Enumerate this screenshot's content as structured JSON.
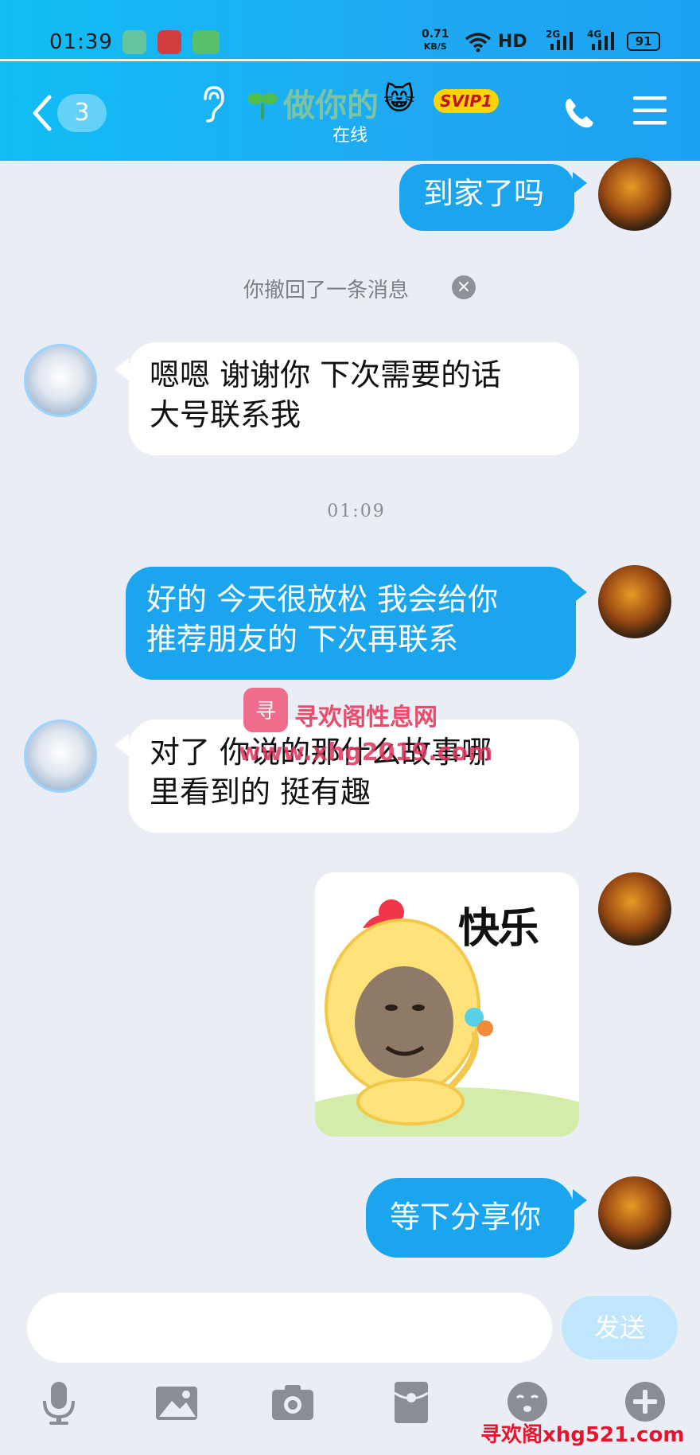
{
  "status_bar": {
    "time": "01:39",
    "net_speed_value": "0.71",
    "net_speed_unit": "KB/S",
    "hd": "HD",
    "sig1": "2G",
    "sig2": "4G",
    "battery": "91"
  },
  "header": {
    "unread_count": "3",
    "contact_name": "做你的",
    "badge": "SVIP1",
    "status": "在线",
    "cat_emoji": "😸"
  },
  "messages": [
    {
      "from": "me",
      "text": "到家了吗"
    },
    {
      "type": "system",
      "text": "你撤回了一条消息"
    },
    {
      "from": "other",
      "text": "嗯嗯 谢谢你 下次需要的话\n大号联系我"
    },
    {
      "type": "timestamp",
      "text": "01:09"
    },
    {
      "from": "me",
      "text": "好的 今天很放松 我会给你\n推荐朋友的 下次再联系"
    },
    {
      "from": "other",
      "text": "对了 你说的那什么故事哪\n里看到的 挺有趣"
    },
    {
      "from": "me",
      "type": "sticker",
      "text": "快乐"
    },
    {
      "from": "me",
      "text": "等下分享你"
    }
  ],
  "watermark": {
    "site_name": "寻欢阁性息网",
    "url": "www.xhg2019.com",
    "bottom": "寻欢阁xhg521.com"
  },
  "input": {
    "placeholder": "",
    "send_label": "发送"
  },
  "toolbar_icons": [
    "microphone-icon",
    "image-icon",
    "camera-icon",
    "red-packet-icon",
    "emoji-icon",
    "plus-icon"
  ],
  "colors": {
    "header_bg": "#1ba2f1",
    "my_bubble": "#1aa5ee",
    "other_bubble": "#ffffff",
    "chat_bg": "#ebedf5"
  }
}
